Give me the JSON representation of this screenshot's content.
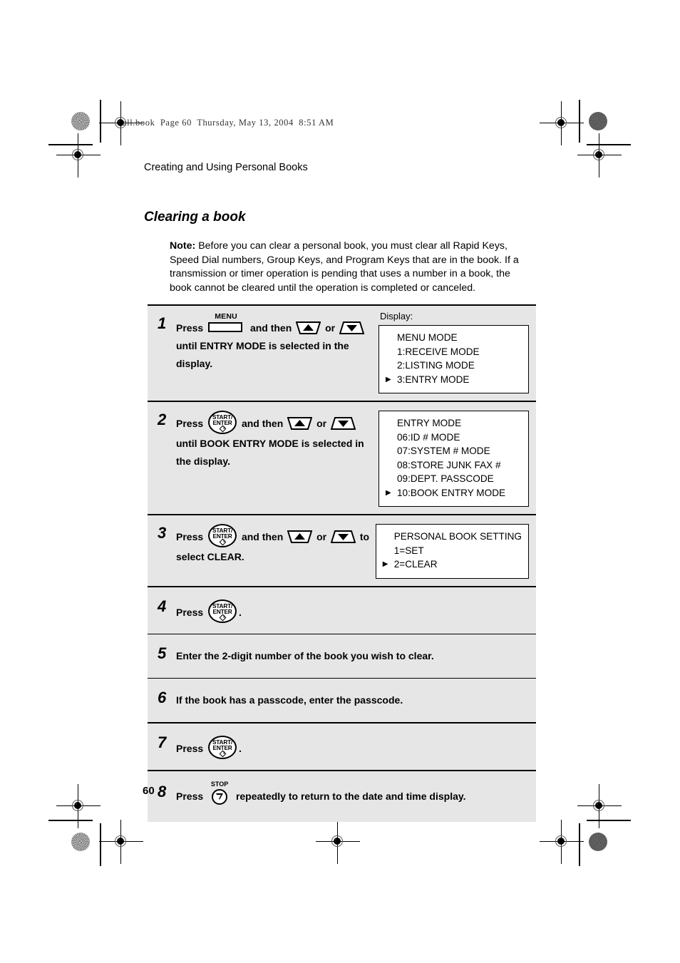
{
  "page": {
    "book_header": "all.book  Page 60  Thursday, May 13, 2004  8:51 AM",
    "running_head": "Creating and Using Personal Books",
    "section_title": "Clearing a book",
    "page_number": "60"
  },
  "note": {
    "label": "Note:",
    "text": " Before you can clear a personal book, you must clear all Rapid Keys, Speed Dial numbers, Group Keys, and Program Keys that are in the book. If a transmission or timer operation is pending that uses a number in a book, the book cannot be cleared until the operation is completed or canceled."
  },
  "display_label": "Display:",
  "keys": {
    "menu": "MENU",
    "start_line1": "START/",
    "start_line2": "ENTER",
    "stop": "STOP",
    "up_arrow": "up-arrow-key",
    "down_arrow": "down-arrow-key"
  },
  "steps": [
    {
      "number": "1",
      "text_a": "Press",
      "text_b": "and then",
      "text_c": "or",
      "text_d": "until ENTRY MODE is selected in the display.",
      "has_display": true,
      "display_caption": "Display:",
      "lcd": [
        {
          "marker": "",
          "text": "MENU MODE",
          "indent": false
        },
        {
          "marker": "",
          "text": "1:RECEIVE MODE",
          "indent": true
        },
        {
          "marker": "",
          "text": "2:LISTING MODE",
          "indent": true
        },
        {
          "marker": "▶",
          "text": "3:ENTRY MODE",
          "indent": false
        }
      ]
    },
    {
      "number": "2",
      "text_a": "Press",
      "text_b": "and then",
      "text_c": "or",
      "text_d": "until BOOK ENTRY MODE is selected in the display.",
      "has_display": true,
      "lcd": [
        {
          "marker": "",
          "text": "ENTRY MODE",
          "indent": false
        },
        {
          "marker": "",
          "text": "06:ID # MODE",
          "indent": true
        },
        {
          "marker": "",
          "text": "07:SYSTEM # MODE",
          "indent": true
        },
        {
          "marker": "",
          "text": "08:STORE JUNK FAX #",
          "indent": true
        },
        {
          "marker": "",
          "text": "09:DEPT. PASSCODE",
          "indent": true
        },
        {
          "marker": "▶",
          "text": "10:BOOK ENTRY MODE",
          "indent": false
        }
      ]
    },
    {
      "number": "3",
      "text_a": "Press",
      "text_b": "and then",
      "text_c": "or",
      "text_d": "to",
      "text_e": "select CLEAR.",
      "has_display": true,
      "lcd": [
        {
          "marker": "",
          "text": "PERSONAL BOOK SETTING",
          "indent": false
        },
        {
          "marker": "",
          "text": "1=SET",
          "indent": true
        },
        {
          "marker": "▶",
          "text": "2=CLEAR",
          "indent": false
        }
      ]
    },
    {
      "number": "4",
      "text_a": "Press",
      "text_b": ".",
      "has_display": false
    },
    {
      "number": "5",
      "text_a": "Enter the 2-digit number of the book you wish to clear.",
      "has_display": false
    },
    {
      "number": "6",
      "text_a": "If the book has a passcode, enter the passcode.",
      "has_display": false
    },
    {
      "number": "7",
      "text_a": "Press",
      "text_b": ".",
      "has_display": false
    },
    {
      "number": "8",
      "text_a": "Press",
      "text_b": "repeatedly to return to the date and time display.",
      "has_display": false
    }
  ]
}
